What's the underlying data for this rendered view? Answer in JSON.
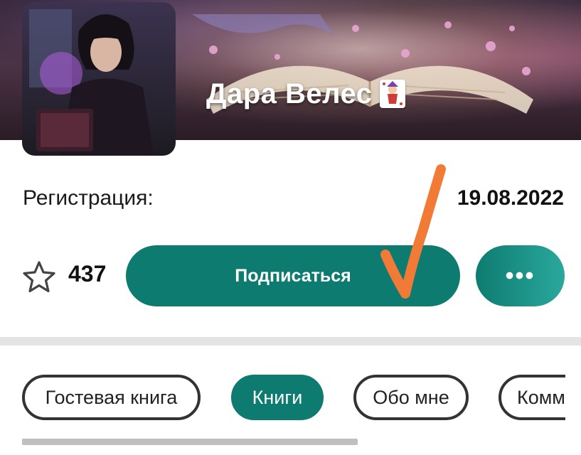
{
  "profile": {
    "name": "Дара Велес",
    "name_emoji_icon": "joker-card-icon"
  },
  "registration": {
    "label": "Регистрация:",
    "date": "19.08.2022"
  },
  "actions": {
    "followers_count": "437",
    "subscribe_label": "Подписаться",
    "more_label": "•••"
  },
  "tabs": [
    {
      "label": "Гостевая книга",
      "active": false
    },
    {
      "label": "Книги",
      "active": true
    },
    {
      "label": "Обо мне",
      "active": false
    },
    {
      "label": "Комм",
      "active": false
    }
  ],
  "colors": {
    "accent": "#0e7b70",
    "annotation": "#f07a36"
  }
}
